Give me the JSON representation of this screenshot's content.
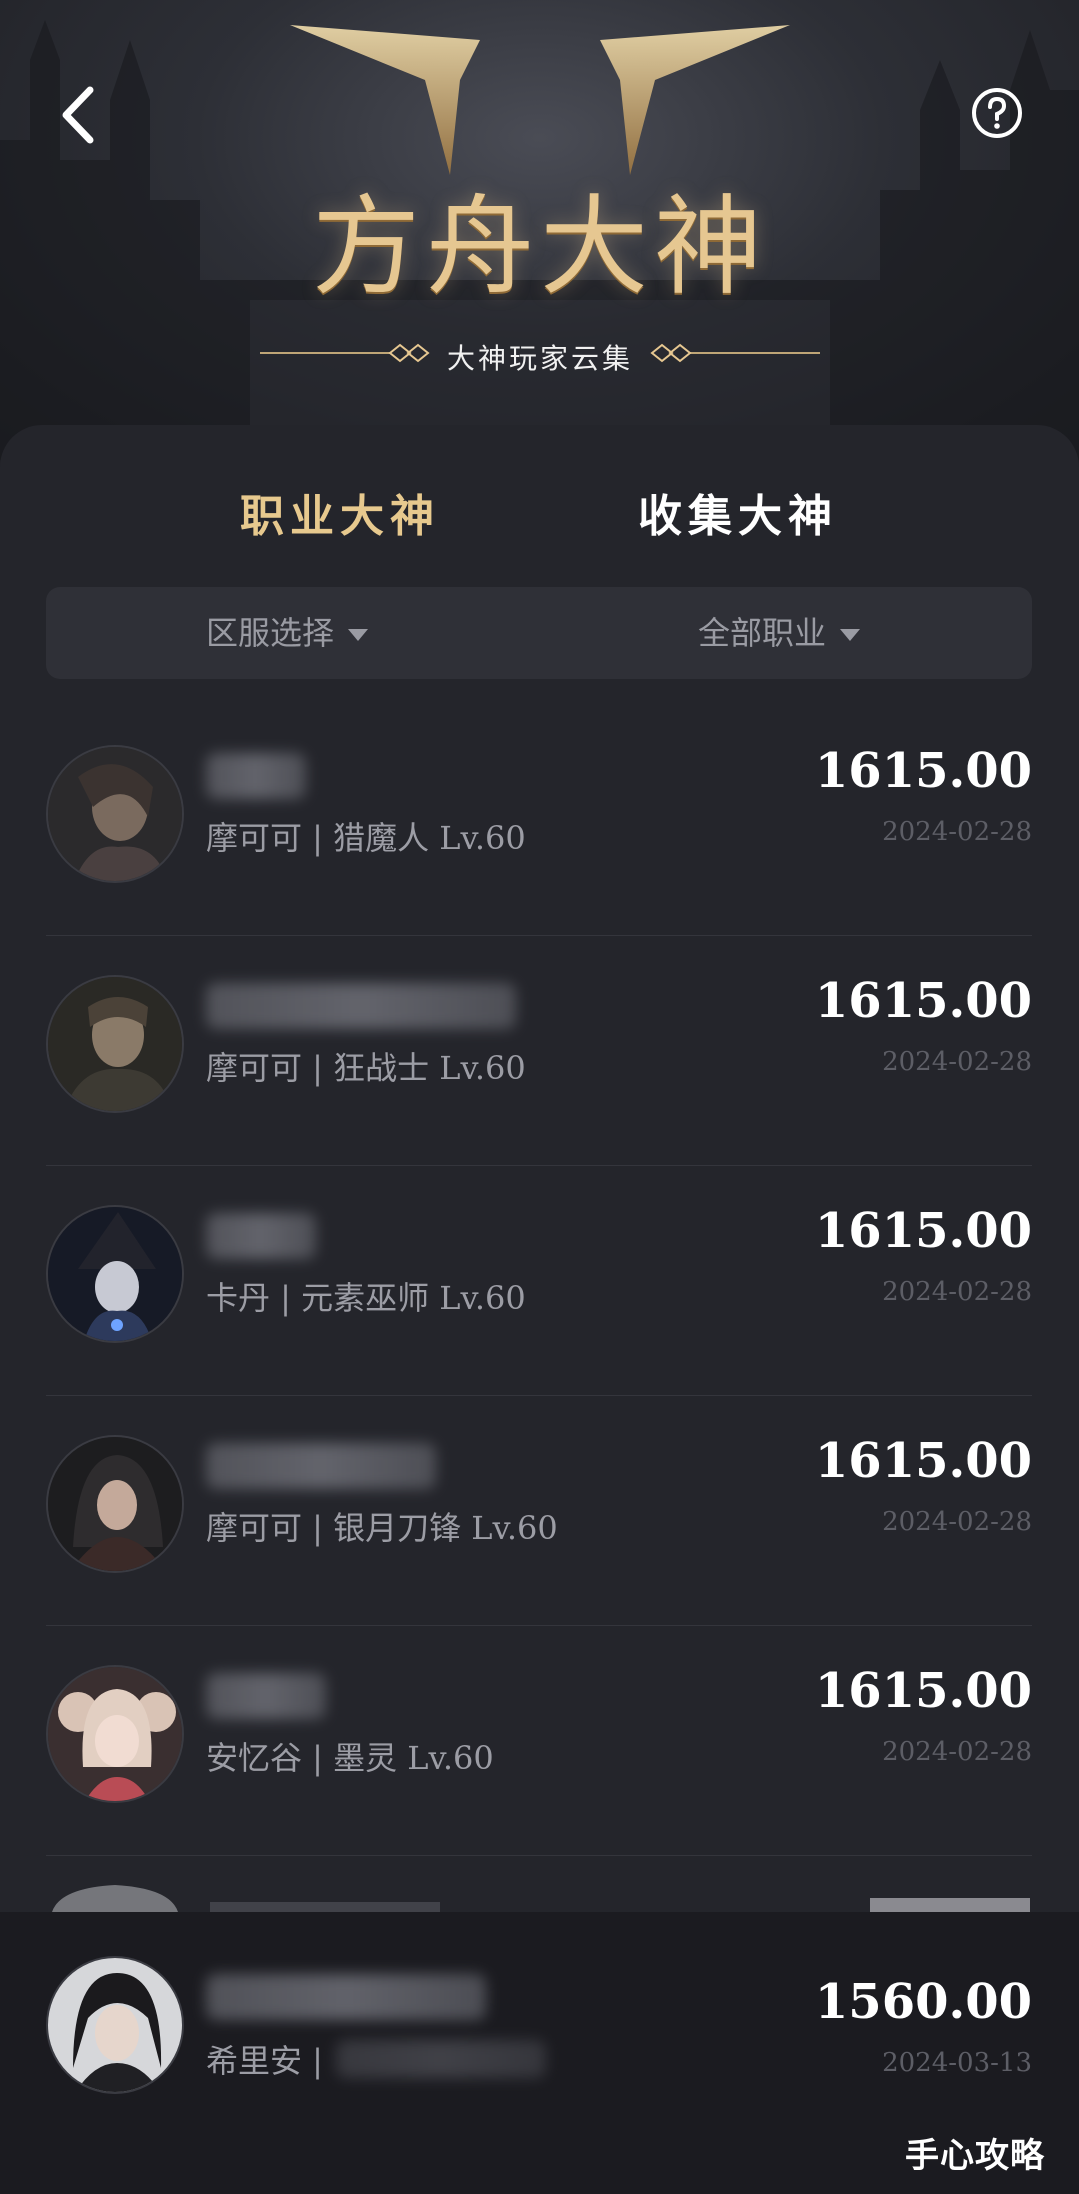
{
  "header": {
    "logo_title": "方舟大神",
    "logo_subtitle": "大神玩家云集",
    "back_icon": "chevron-left-icon",
    "help_icon": "question-circle-icon"
  },
  "tabs": [
    {
      "label": "职业大神",
      "active": true
    },
    {
      "label": "收集大神",
      "active": false
    }
  ],
  "filters": {
    "server": "区服选择",
    "job": "全部职业"
  },
  "colors": {
    "accent_gold": "#e7c98e",
    "panel_bg": "#24252b",
    "muted_text": "#9c9da5"
  },
  "players": [
    {
      "sub": "摩可可 | 猎魔人 Lv.60",
      "score": "1615.00",
      "date": "2024-02-28"
    },
    {
      "sub": "摩可可 | 狂战士 Lv.60",
      "score": "1615.00",
      "date": "2024-02-28"
    },
    {
      "sub": "卡丹 | 元素巫师 Lv.60",
      "score": "1615.00",
      "date": "2024-02-28"
    },
    {
      "sub": "摩可可 | 银月刀锋 Lv.60",
      "score": "1615.00",
      "date": "2024-02-28"
    },
    {
      "sub": "安忆谷 | 墨灵 Lv.60",
      "score": "1615.00",
      "date": "2024-02-28"
    }
  ],
  "me": {
    "sub": "希里安 |",
    "score": "1560.00",
    "date": "2024-03-13"
  },
  "watermark": "手心攻略"
}
